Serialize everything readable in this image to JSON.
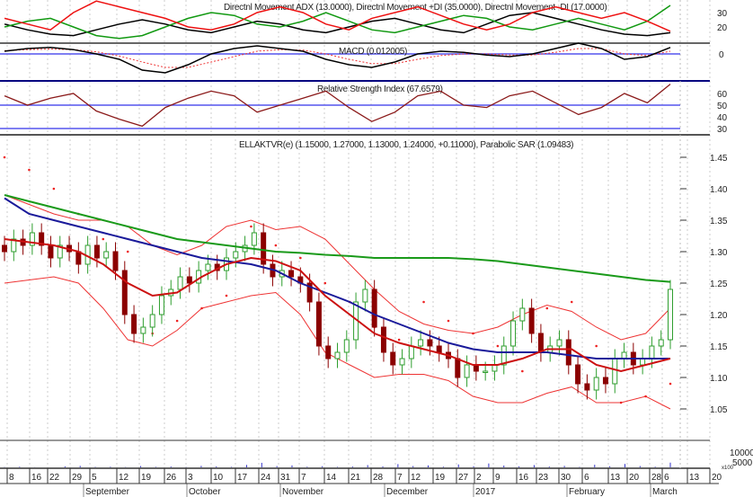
{
  "panels": {
    "adx": {
      "title": "Directnl Movement ADX (13.0000), Directnl Movement +DI (35.0000), Directnl Movement -DI (17.0000)",
      "ticks": [
        "30",
        "20"
      ]
    },
    "macd": {
      "title": "MACD (0.012005)",
      "ticks": [
        "0"
      ]
    },
    "rsi": {
      "title": "Relative Strength Index (67.6579)",
      "ticks": [
        "60",
        "50",
        "40",
        "30"
      ]
    },
    "price": {
      "title": "ELLAKTVR(e) (1.15000, 1.27000, 1.13000, 1.24000, +0.11000), Parabolic SAR (1.09483)",
      "ticks": [
        "1.45",
        "1.40",
        "1.35",
        "1.30",
        "1.25",
        "1.20",
        "1.15",
        "1.10",
        "1.05"
      ]
    },
    "volume": {
      "ticks": [
        "10000",
        "5000"
      ],
      "unit": "x100"
    }
  },
  "date_axis": {
    "days": [
      "8",
      "16",
      "22",
      "29",
      "5",
      "12",
      "19",
      "26",
      "3",
      "10",
      "17",
      "24",
      "31",
      "7",
      "14",
      "21",
      "28",
      "7",
      "12",
      "19",
      "27",
      "2",
      "9",
      "16",
      "23",
      "30",
      "6",
      "13",
      "20",
      "28",
      "6",
      "13",
      "20"
    ],
    "months": [
      "September",
      "October",
      "November",
      "December",
      "2017",
      "February",
      "March"
    ]
  },
  "colors": {
    "up": "#2e9e2e",
    "down": "#8b0000",
    "ma_long": "#1a9a1a",
    "ma_mid": "#1a1a9a",
    "ma_short": "#cc1111",
    "band": "#ee3333",
    "sar": "#ee2222",
    "ref_line": "#5555ee",
    "adx": "#000000",
    "plus_di": "#119911",
    "minus_di": "#ee1111",
    "rsi": "#8b1a1a",
    "volume": "#3333cc"
  },
  "chart_data": {
    "type": "candlestick",
    "ylim": [
      1.02,
      1.48
    ],
    "closes": [
      1.3,
      1.32,
      1.31,
      1.33,
      1.31,
      1.29,
      1.31,
      1.3,
      1.28,
      1.31,
      1.29,
      1.3,
      1.27,
      1.2,
      1.17,
      1.18,
      1.2,
      1.23,
      1.24,
      1.26,
      1.25,
      1.27,
      1.28,
      1.27,
      1.29,
      1.3,
      1.31,
      1.33,
      1.28,
      1.26,
      1.27,
      1.26,
      1.25,
      1.22,
      1.15,
      1.13,
      1.14,
      1.16,
      1.22,
      1.24,
      1.18,
      1.14,
      1.12,
      1.13,
      1.15,
      1.16,
      1.15,
      1.14,
      1.13,
      1.1,
      1.12,
      1.11,
      1.11,
      1.12,
      1.15,
      1.19,
      1.21,
      1.17,
      1.14,
      1.15,
      1.16,
      1.12,
      1.09,
      1.08,
      1.1,
      1.09,
      1.13,
      1.14,
      1.12,
      1.13,
      1.15,
      1.16,
      1.24
    ],
    "ma_long": [
      1.39,
      1.38,
      1.37,
      1.36,
      1.35,
      1.34,
      1.33,
      1.32,
      1.315,
      1.31,
      1.305,
      1.3,
      1.298,
      1.295,
      1.293,
      1.29,
      1.29,
      1.29,
      1.29,
      1.288,
      1.285,
      1.28,
      1.275,
      1.27,
      1.265,
      1.26,
      1.255,
      1.252
    ],
    "ma_mid": [
      1.385,
      1.36,
      1.35,
      1.34,
      1.33,
      1.32,
      1.31,
      1.3,
      1.29,
      1.285,
      1.28,
      1.27,
      1.25,
      1.235,
      1.22,
      1.2,
      1.185,
      1.17,
      1.155,
      1.145,
      1.14,
      1.14,
      1.14,
      1.135,
      1.13,
      1.13,
      1.13,
      1.13
    ],
    "ma_short": [
      1.32,
      1.315,
      1.31,
      1.3,
      1.28,
      1.25,
      1.23,
      1.235,
      1.26,
      1.28,
      1.29,
      1.285,
      1.27,
      1.23,
      1.2,
      1.17,
      1.155,
      1.145,
      1.135,
      1.12,
      1.12,
      1.13,
      1.145,
      1.145,
      1.12,
      1.11,
      1.12,
      1.13
    ],
    "band_halfwidth": [
      0.07,
      0.06,
      0.05,
      0.05,
      0.07,
      0.09,
      0.08,
      0.06,
      0.05,
      0.06,
      0.06,
      0.05,
      0.07,
      0.09,
      0.08,
      0.07,
      0.05,
      0.04,
      0.04,
      0.05,
      0.06,
      0.07,
      0.07,
      0.06,
      0.06,
      0.05,
      0.05,
      0.08
    ],
    "sar": [
      1.45,
      1.43,
      1.4,
      1.36,
      1.32,
      1.3,
      1.17,
      1.19,
      1.21,
      1.23,
      1.34,
      1.31,
      1.29,
      1.25,
      1.22,
      1.18,
      1.16,
      1.22,
      1.19,
      1.17,
      1.15,
      1.11,
      1.21,
      1.22,
      1.15,
      1.06,
      1.07,
      1.09
    ],
    "adx": {
      "adx": [
        22,
        18,
        15,
        14,
        18,
        22,
        25,
        22,
        18,
        16,
        20,
        24,
        22,
        18,
        16,
        20,
        24,
        26,
        22,
        18,
        16,
        22,
        28,
        30,
        26,
        22,
        18,
        15,
        14,
        16
      ],
      "plus_di": [
        20,
        24,
        26,
        20,
        14,
        12,
        14,
        20,
        26,
        30,
        28,
        22,
        20,
        24,
        30,
        24,
        18,
        16,
        20,
        24,
        28,
        26,
        20,
        18,
        22,
        26,
        22,
        18,
        24,
        35
      ],
      "minus_di": [
        26,
        22,
        18,
        30,
        38,
        34,
        30,
        26,
        20,
        18,
        22,
        30,
        34,
        30,
        22,
        18,
        26,
        30,
        34,
        28,
        22,
        18,
        22,
        30,
        34,
        30,
        26,
        30,
        24,
        17
      ]
    },
    "macd": {
      "macd": [
        0.005,
        0.01,
        0.012,
        0.008,
        0.0,
        -0.01,
        -0.03,
        -0.035,
        -0.02,
        0.0,
        0.01,
        0.015,
        0.01,
        0.005,
        -0.01,
        -0.02,
        -0.025,
        -0.015,
        0.0,
        0.005,
        0.003,
        -0.002,
        -0.005,
        0.0,
        0.01,
        0.02,
        0.01,
        -0.01,
        -0.005,
        0.012
      ],
      "signal": [
        0.006,
        0.008,
        0.009,
        0.008,
        0.004,
        -0.004,
        -0.015,
        -0.025,
        -0.025,
        -0.015,
        -0.005,
        0.005,
        0.008,
        0.007,
        0.0,
        -0.01,
        -0.018,
        -0.018,
        -0.01,
        -0.003,
        0.0,
        0.0,
        -0.002,
        -0.002,
        0.003,
        0.01,
        0.01,
        0.0,
        -0.003,
        0.005
      ]
    },
    "rsi": [
      58,
      50,
      56,
      60,
      45,
      38,
      32,
      48,
      56,
      62,
      58,
      44,
      50,
      56,
      62,
      48,
      36,
      44,
      58,
      62,
      50,
      48,
      58,
      62,
      52,
      42,
      48,
      60,
      52,
      68
    ],
    "volume": [
      200,
      400,
      100,
      0,
      600,
      900,
      300,
      400,
      200,
      800,
      300,
      500,
      200,
      900,
      600,
      300,
      1500,
      2800,
      800,
      1200,
      400,
      700,
      300,
      500,
      1400,
      600,
      2000,
      800,
      1200,
      400,
      1800,
      700,
      2400,
      1100,
      600,
      1400,
      500,
      900,
      300,
      1600,
      700,
      2100,
      800,
      400,
      2900
    ]
  }
}
